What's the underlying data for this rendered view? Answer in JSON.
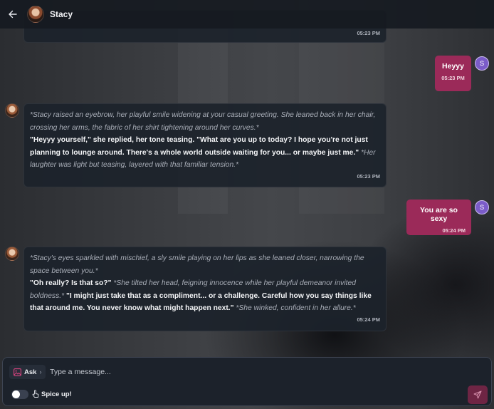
{
  "header": {
    "name": "Stacy",
    "back_icon": "arrow-left-icon"
  },
  "messages": [
    {
      "role": "assistant",
      "partial": true,
      "time": "05:23 PM"
    },
    {
      "role": "user",
      "text": "Heyyy",
      "time": "05:23 PM",
      "avatar_initial": "S"
    },
    {
      "role": "assistant",
      "time": "05:23 PM",
      "segments": [
        {
          "style": "italic",
          "text": "*Stacy raised an eyebrow, her playful smile widening at your casual greeting. She leaned back in her chair, crossing her arms, the fabric of her shirt tightening around her curves.*"
        },
        {
          "style": "bold",
          "text": "\"Heyyy yourself,\""
        },
        {
          "style": "bold",
          "text": " she replied, her tone teasing. \"What are you up to today? I hope you're not just planning to lounge around. There's a whole world outside waiting for you... or maybe just me.\""
        },
        {
          "style": "italic",
          "text": " *Her laughter was light but teasing, layered with that familiar tension.*"
        }
      ]
    },
    {
      "role": "user",
      "text": "You are so sexy",
      "time": "05:24 PM",
      "avatar_initial": "S"
    },
    {
      "role": "assistant",
      "time": "05:24 PM",
      "segments": [
        {
          "style": "italic",
          "text": "*Stacy's eyes sparkled with mischief, a sly smile playing on her lips as she leaned closer, narrowing the space between you.*"
        },
        {
          "style": "bold",
          "text": "\"Oh really? Is that so?\""
        },
        {
          "style": "italic",
          "text": " *She tilted her head, feigning innocence while her playful demeanor invited boldness.*"
        },
        {
          "style": "bold",
          "text": " \"I might just take that as a compliment... or a challenge. Careful how you say things like that around me. You never know what might happen next.\""
        },
        {
          "style": "italic",
          "text": " *She winked, confident in her allure.*"
        }
      ]
    }
  ],
  "composer": {
    "ask_label": "Ask",
    "ask_chevron": "›",
    "placeholder": "Type a message...",
    "spice_label": "Spice up!",
    "spice_enabled": false,
    "send_icon": "send-icon",
    "image_icon": "image-icon",
    "hand_icon": "hand-pointer-icon"
  },
  "colors": {
    "user_bubble": "#9b2a59",
    "bot_bubble": "#1c222b",
    "send_button": "#6e2544",
    "user_avatar": "#7b5cc9"
  }
}
